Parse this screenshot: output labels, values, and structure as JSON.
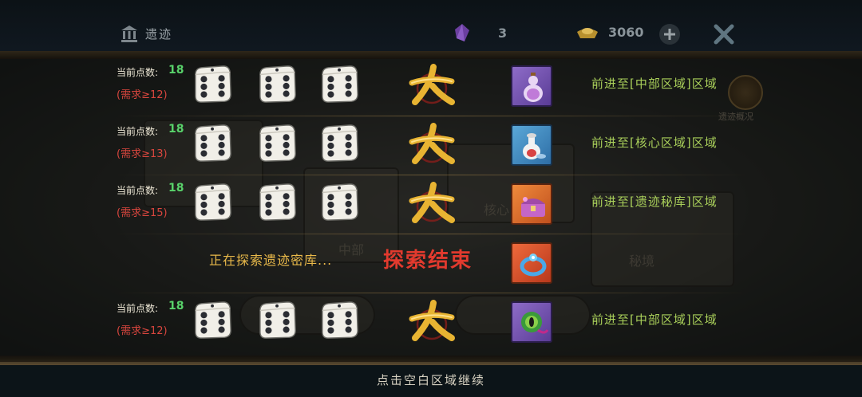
{
  "header": {
    "title": "遗迹",
    "title_icon": "temple-icon",
    "gem_icon": "purple-crystal-icon",
    "gem_count": "3",
    "gold_icon": "gold-ingot-icon",
    "gold_count": "3060"
  },
  "map": {
    "labels": [
      "中部",
      "核心",
      "秘境"
    ],
    "side_button_label": "遗迹概况"
  },
  "rows": [
    {
      "points_label": "当前点数:",
      "points": "18",
      "requirement": "(需求≥12)",
      "dice": [
        6,
        6,
        6
      ],
      "result": "大",
      "item_icon": "potion-gourd-icon",
      "destination": "前进至[中部区域]区域"
    },
    {
      "points_label": "当前点数:",
      "points": "18",
      "requirement": "(需求≥13)",
      "dice": [
        6,
        6,
        6
      ],
      "result": "大",
      "item_icon": "vase-icon",
      "destination": "前进至[核心区域]区域"
    },
    {
      "points_label": "当前点数:",
      "points": "18",
      "requirement": "(需求≥15)",
      "dice": [
        6,
        6,
        6
      ],
      "result": "大",
      "item_icon": "treasure-chest-icon",
      "destination": "前进至[遗迹秘库]区域"
    },
    {
      "points_label": "当前点数:",
      "points": "18",
      "requirement": "(需求≥12)",
      "dice": [
        6,
        6,
        6
      ],
      "result": "大",
      "item_icon": "eye-orb-icon",
      "destination": "前进至[中部区域]区域"
    }
  ],
  "explore": {
    "status": "正在探索遗迹密库...",
    "end": "探索结束",
    "item_icon": "ring-icon"
  },
  "footer": {
    "continue_hint": "点击空白区域继续"
  },
  "colors": {
    "points": "#59d36b",
    "requirement": "#d9463e",
    "destination": "#a9cf5a",
    "explore_end": "#e23a2e",
    "explore_status": "#e9b94a"
  }
}
